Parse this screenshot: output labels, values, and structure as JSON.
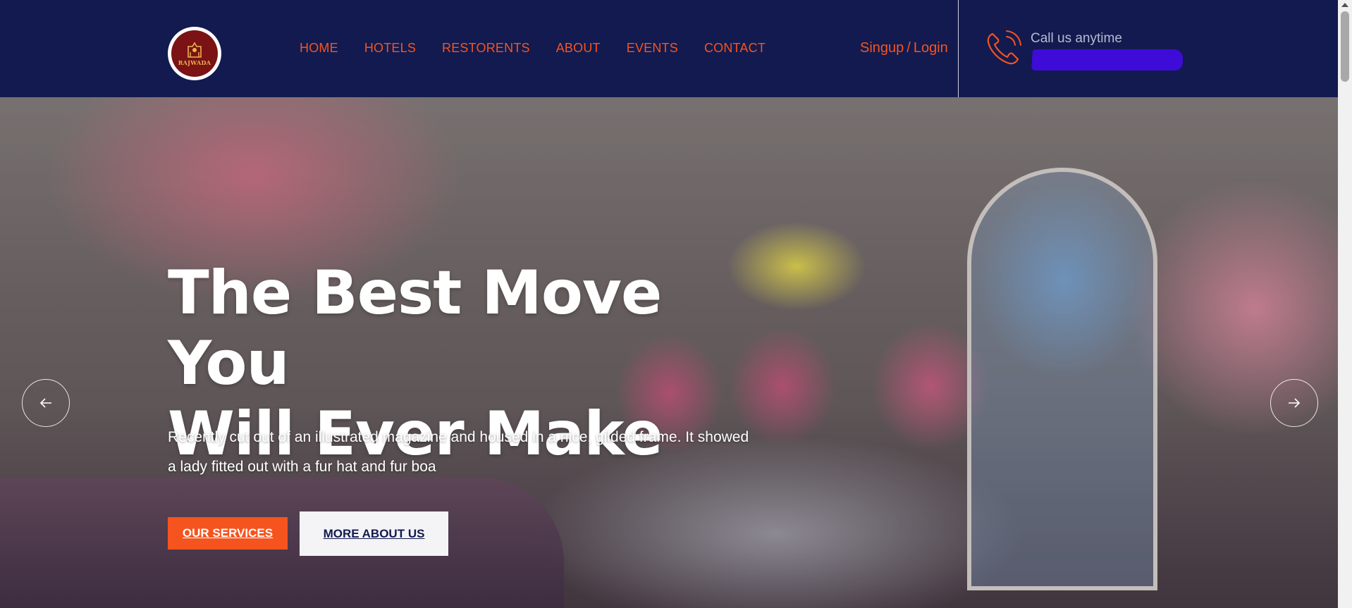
{
  "header": {
    "logo_text": "RAJWADA",
    "nav": [
      {
        "label": "HOME"
      },
      {
        "label": "HOTELS"
      },
      {
        "label": "RESTORENTS"
      },
      {
        "label": "ABOUT"
      },
      {
        "label": "EVENTS"
      },
      {
        "label": "CONTACT"
      }
    ],
    "signup_label": "Singup",
    "separator": "/",
    "login_label": "Login",
    "call_label": "Call us anytime",
    "phone_icon": "phone-icon"
  },
  "hero": {
    "title_line1": "The Best Move You",
    "title_line2": "Will Ever Make",
    "text": "Recently cut out of an illustrated magazine and housed in a nice, gilded frame. It showed a lady fitted out with a fur hat and fur boa",
    "services_button": "OUR SERVICES",
    "about_button": "MORE ABOUT US",
    "prev_icon": "arrow-left-icon",
    "next_icon": "arrow-right-icon"
  },
  "colors": {
    "header_bg": "#121a4f",
    "accent": "#f5541f",
    "redacted_phone": "#3f0bd8"
  }
}
